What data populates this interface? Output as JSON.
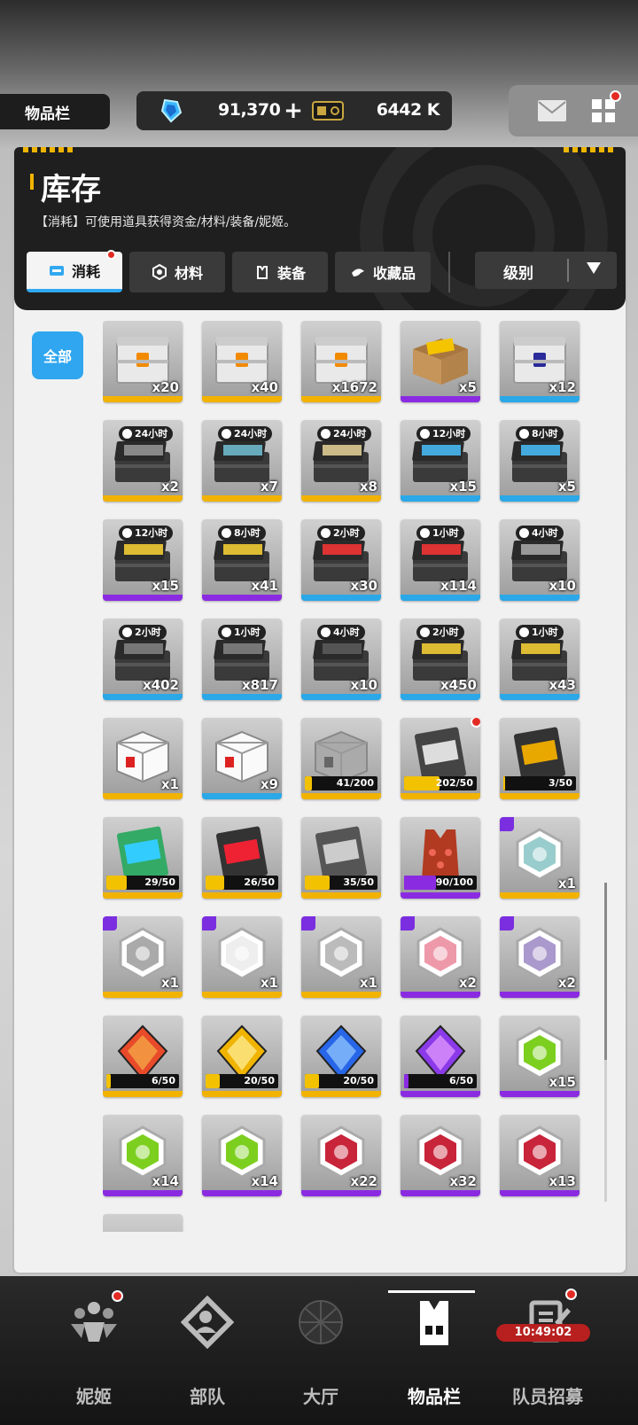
{
  "header": {
    "page_tag": "物品栏",
    "gems": "91,370",
    "plus": "+",
    "credits": "6442 K"
  },
  "panel": {
    "title": "库存",
    "desc": "【消耗】可使用道具获得资金/材料/装备/妮姬。",
    "tabs": [
      "消耗",
      "材料",
      "装备",
      "收藏品"
    ],
    "sort_label": "级别",
    "filter_all": "全部"
  },
  "items": [
    {
      "kind": "crate",
      "count": "x20",
      "rarity": "#f2b300",
      "color": "#e9e9e9",
      "accent": "#f28a00"
    },
    {
      "kind": "crate",
      "count": "x40",
      "rarity": "#f2b300",
      "color": "#e9e9e9",
      "accent": "#f28a00"
    },
    {
      "kind": "crate",
      "count": "x1672",
      "rarity": "#f2b300",
      "color": "#e9e9e9",
      "accent": "#f28a00"
    },
    {
      "kind": "box",
      "count": "x5",
      "rarity": "#8a2be2",
      "color": "#c6955a",
      "accent": "#f5c400"
    },
    {
      "kind": "crate",
      "count": "x12",
      "rarity": "#2aa8e8",
      "color": "#e9e9e9",
      "accent": "#2a2a9a"
    },
    {
      "kind": "case",
      "pill": "24小时",
      "count": "x2",
      "rarity": "#f2b300",
      "color": "#888"
    },
    {
      "kind": "case",
      "pill": "24小时",
      "count": "x7",
      "rarity": "#f2b300",
      "color": "#6ab"
    },
    {
      "kind": "case",
      "pill": "24小时",
      "count": "x8",
      "rarity": "#f2b300",
      "color": "#cb8"
    },
    {
      "kind": "case",
      "pill": "12小时",
      "count": "x15",
      "rarity": "#2aa8e8",
      "color": "#4ad"
    },
    {
      "kind": "case",
      "pill": "8小时",
      "count": "x5",
      "rarity": "#2aa8e8",
      "color": "#4ad"
    },
    {
      "kind": "case",
      "pill": "12小时",
      "count": "x15",
      "rarity": "#8a2be2",
      "color": "#db3"
    },
    {
      "kind": "case",
      "pill": "8小时",
      "count": "x41",
      "rarity": "#8a2be2",
      "color": "#db3"
    },
    {
      "kind": "case",
      "pill": "2小时",
      "count": "x30",
      "rarity": "#2aa8e8",
      "color": "#d33"
    },
    {
      "kind": "case",
      "pill": "1小时",
      "count": "x114",
      "rarity": "#2aa8e8",
      "color": "#d33"
    },
    {
      "kind": "case",
      "pill": "4小时",
      "count": "x10",
      "rarity": "#2aa8e8",
      "color": "#999"
    },
    {
      "kind": "case",
      "pill": "2小时",
      "count": "x402",
      "rarity": "#2aa8e8",
      "color": "#777"
    },
    {
      "kind": "case",
      "pill": "1小时",
      "count": "x817",
      "rarity": "#2aa8e8",
      "color": "#777"
    },
    {
      "kind": "case",
      "pill": "4小时",
      "count": "x10",
      "rarity": "#2aa8e8",
      "color": "#555"
    },
    {
      "kind": "case",
      "pill": "2小时",
      "count": "x450",
      "rarity": "#2aa8e8",
      "color": "#db3"
    },
    {
      "kind": "case",
      "pill": "1小时",
      "count": "x43",
      "rarity": "#2aa8e8",
      "color": "#db3"
    },
    {
      "kind": "cube",
      "count": "x1",
      "rarity": "#f2b300",
      "color": "#fafafa",
      "accent": "#d22"
    },
    {
      "kind": "cube",
      "count": "x9",
      "rarity": "#2aa8e8",
      "color": "#fafafa",
      "accent": "#d22"
    },
    {
      "kind": "cube",
      "progress": "41/200",
      "pct": 0.205,
      "rarity": "#f2b300",
      "color": "#aaa",
      "accent": "#666"
    },
    {
      "kind": "card",
      "progress": "202/50",
      "pct": 1,
      "rarity": "#f2b300",
      "color": "#444",
      "accent": "#ddd",
      "dot": true
    },
    {
      "kind": "card",
      "progress": "3/50",
      "pct": 0.06,
      "rarity": "#f2b300",
      "color": "#333",
      "accent": "#e9a800"
    },
    {
      "kind": "card",
      "progress": "29/50",
      "pct": 0.58,
      "rarity": "#f2b300",
      "color": "#3a6",
      "accent": "#3cf"
    },
    {
      "kind": "card",
      "progress": "26/50",
      "pct": 0.52,
      "rarity": "#f2b300",
      "color": "#333",
      "accent": "#e23"
    },
    {
      "kind": "card",
      "progress": "35/50",
      "pct": 0.7,
      "rarity": "#f2b300",
      "color": "#555",
      "accent": "#ccc"
    },
    {
      "kind": "vest",
      "progress": "90/100",
      "pct": 0.9,
      "rarity": "#8a2be2",
      "color": "#b23a20",
      "accent": "#e65"
    },
    {
      "kind": "hex",
      "count": "x1",
      "rarity": "#f2b300",
      "color": "#f2f2f2",
      "accent": "#9cc",
      "badge": true
    },
    {
      "kind": "hex",
      "count": "x1",
      "rarity": "#f2b300",
      "color": "#f2f2f2",
      "accent": "#aaa",
      "badge": true
    },
    {
      "kind": "hex",
      "count": "x1",
      "rarity": "#f2b300",
      "color": "#f2f2f2",
      "accent": "#eee",
      "badge": true
    },
    {
      "kind": "hex",
      "count": "x1",
      "rarity": "#f2b300",
      "color": "#f2f2f2",
      "accent": "#bbb",
      "badge": true
    },
    {
      "kind": "hex",
      "count": "x2",
      "rarity": "#8a2be2",
      "color": "#f2f2f2",
      "accent": "#e9a",
      "badge": true
    },
    {
      "kind": "hex",
      "count": "x2",
      "rarity": "#8a2be2",
      "color": "#f2f2f2",
      "accent": "#a9c",
      "badge": true
    },
    {
      "kind": "gem",
      "progress": "6/50",
      "pct": 0.12,
      "rarity": "#f2b300",
      "color": "#e84a2a",
      "accent": "#f6b14a"
    },
    {
      "kind": "gem",
      "progress": "20/50",
      "pct": 0.4,
      "rarity": "#f2b300",
      "color": "#f0b400",
      "accent": "#fff0a0"
    },
    {
      "kind": "gem",
      "progress": "20/50",
      "pct": 0.4,
      "rarity": "#f2b300",
      "color": "#2766e8",
      "accent": "#9cf"
    },
    {
      "kind": "gem",
      "progress": "6/50",
      "pct": 0.12,
      "rarity": "#8a2be2",
      "color": "#8a3ae8",
      "accent": "#e9a0ff"
    },
    {
      "kind": "hex",
      "count": "x15",
      "rarity": "#8a2be2",
      "color": "#f2f2f2",
      "accent": "#7ccf1f"
    },
    {
      "kind": "hex",
      "count": "x14",
      "rarity": "#8a2be2",
      "color": "#f2f2f2",
      "accent": "#7ccf1f"
    },
    {
      "kind": "hex",
      "count": "x14",
      "rarity": "#8a2be2",
      "color": "#f2f2f2",
      "accent": "#7ccf1f"
    },
    {
      "kind": "hex",
      "count": "x22",
      "rarity": "#8a2be2",
      "color": "#f2f2f2",
      "accent": "#c8243a"
    },
    {
      "kind": "hex",
      "count": "x32",
      "rarity": "#8a2be2",
      "color": "#f2f2f2",
      "accent": "#c8243a"
    },
    {
      "kind": "hex",
      "count": "x13",
      "rarity": "#8a2be2",
      "color": "#f2f2f2",
      "accent": "#c8243a"
    }
  ],
  "nav": {
    "items": [
      "妮姬",
      "部队",
      "大厅",
      "物品栏",
      "队员招募"
    ],
    "active": 3,
    "timer": "10:49:02"
  },
  "colors": {
    "accent_blue": "#31a8ef",
    "rarity_ssr": "#f2b300",
    "rarity_sr": "#8a2be2",
    "rarity_r": "#2aa8e8",
    "notification_red": "#e32b24"
  }
}
